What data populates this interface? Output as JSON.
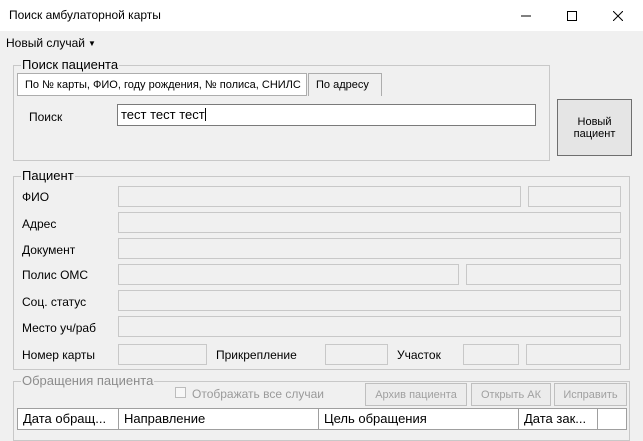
{
  "window": {
    "title": "Поиск амбулаторной карты",
    "minimize_icon": "minimize-icon",
    "maximize_icon": "maximize-icon",
    "close_icon": "close-icon"
  },
  "menu": {
    "new_case_label": "Новый случай"
  },
  "search_group": {
    "legend": "Поиск пациента",
    "tabs": [
      {
        "label": "По № карты, ФИО, году рождения, № полиса, СНИЛС",
        "active": true
      },
      {
        "label": "По адресу",
        "active": false
      }
    ],
    "search_label": "Поиск",
    "search_value": "тест тест тест",
    "new_patient_label": "Новый пациент"
  },
  "patient_group": {
    "legend": "Пациент",
    "fio_label": "ФИО",
    "address_label": "Адрес",
    "document_label": "Документ",
    "policy_label": "Полис ОМС",
    "social_status_label": "Соц. статус",
    "workplace_label": "Место уч/раб",
    "card_number_label": "Номер карты",
    "attachment_label": "Прикрепление",
    "district_label": "Участок"
  },
  "appeals_group": {
    "legend": "Обращения пациента",
    "show_all_label": "Отображать все случаи",
    "show_all_checked": false,
    "archive_button": "Архив пациента",
    "open_ak_button": "Открыть АК",
    "fix_button": "Исправить",
    "columns": [
      "Дата обращ...",
      "Направление",
      "Цель обращения",
      "Дата зак..."
    ]
  }
}
